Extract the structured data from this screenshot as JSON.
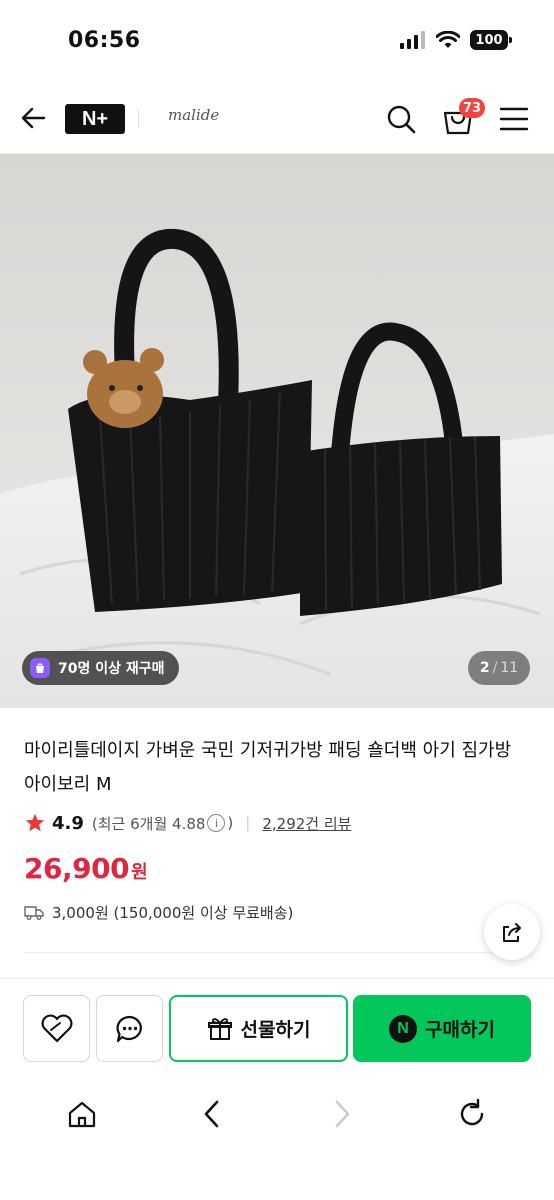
{
  "status_bar": {
    "time": "06:56",
    "battery": "100"
  },
  "header": {
    "nplus_label": "N+",
    "brand_name": "malide",
    "cart_count": "73"
  },
  "gallery": {
    "repurchase_badge": "70명 이상 재구매",
    "current_page": "2",
    "total_pages": "11"
  },
  "product": {
    "title": "마이리틀데이지 가벼운 국민 기저귀가방 패딩 숄더백 아기 짐가방 아이보리 M",
    "rating": "4.9",
    "recent_rating": "(최근 6개월 4.88",
    "recent_rating_close": ")",
    "review_count": "2,292건 리뷰",
    "price": "26,900",
    "price_unit": "원",
    "shipping": "3,000원 (150,000원 이상 무료배송)"
  },
  "actions": {
    "gift_label": "선물하기",
    "buy_label": "구매하기",
    "npay_mark": "N"
  },
  "colors": {
    "accent_green": "#03c75a",
    "price_red": "#e1253f",
    "badge_red": "#f5433b",
    "badge_purple": "#8b5cf6"
  }
}
